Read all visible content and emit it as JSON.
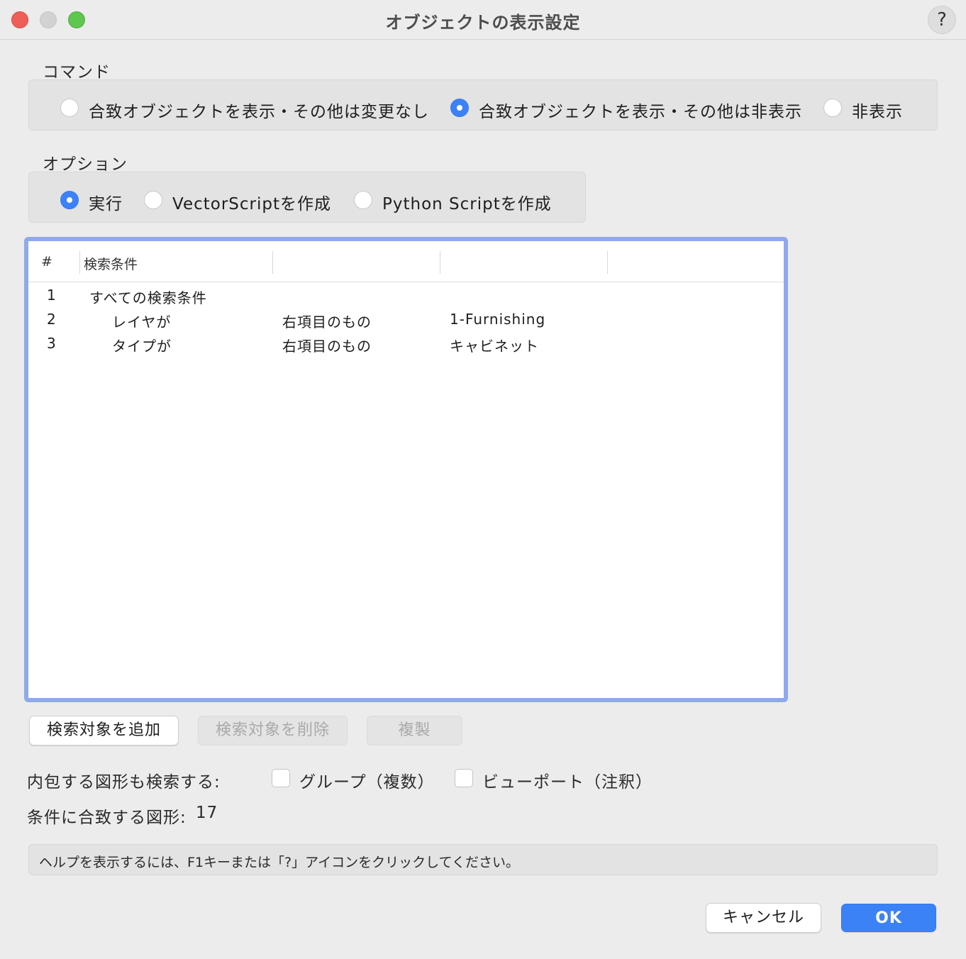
{
  "window": {
    "title": "オブジェクトの表示設定",
    "help_label": "?"
  },
  "command": {
    "label": "コマンド",
    "options": [
      {
        "label": "合致オブジェクトを表示・その他は変更なし",
        "selected": false
      },
      {
        "label": "合致オブジェクトを表示・その他は非表示",
        "selected": true
      },
      {
        "label": "非表示",
        "selected": false
      }
    ]
  },
  "option": {
    "label": "オプション",
    "options": [
      {
        "label": "実行",
        "selected": true
      },
      {
        "label": "VectorScriptを作成",
        "selected": false
      },
      {
        "label": "Python Scriptを作成",
        "selected": false
      }
    ]
  },
  "table": {
    "headers": [
      "#",
      "検索条件",
      "",
      "",
      ""
    ],
    "rows": [
      {
        "num": "1",
        "c1": "すべての検索条件",
        "c2": "",
        "c3": ""
      },
      {
        "num": "2",
        "c1": "レイヤが",
        "c2": "右項目のもの",
        "c3": "1-Furnishing"
      },
      {
        "num": "3",
        "c1": "タイプが",
        "c2": "右項目のもの",
        "c3": "キャビネット"
      }
    ]
  },
  "buttons": {
    "add": "検索対象を追加",
    "delete": "検索対象を削除",
    "duplicate": "複製",
    "cancel": "キャンセル",
    "ok": "OK"
  },
  "search_nested": {
    "label": "内包する図形も検索する:",
    "group": {
      "label": "グループ（複数）",
      "checked": false
    },
    "viewport": {
      "label": "ビューポート（注釈）",
      "checked": false
    }
  },
  "match": {
    "label": "条件に合致する図形:",
    "count": "17"
  },
  "hint": "ヘルプを表示するには、F1キーまたは「?」アイコンをクリックしてください。",
  "colors": {
    "accent": "#3b82f6",
    "table_focus": "#8fa9ec"
  }
}
